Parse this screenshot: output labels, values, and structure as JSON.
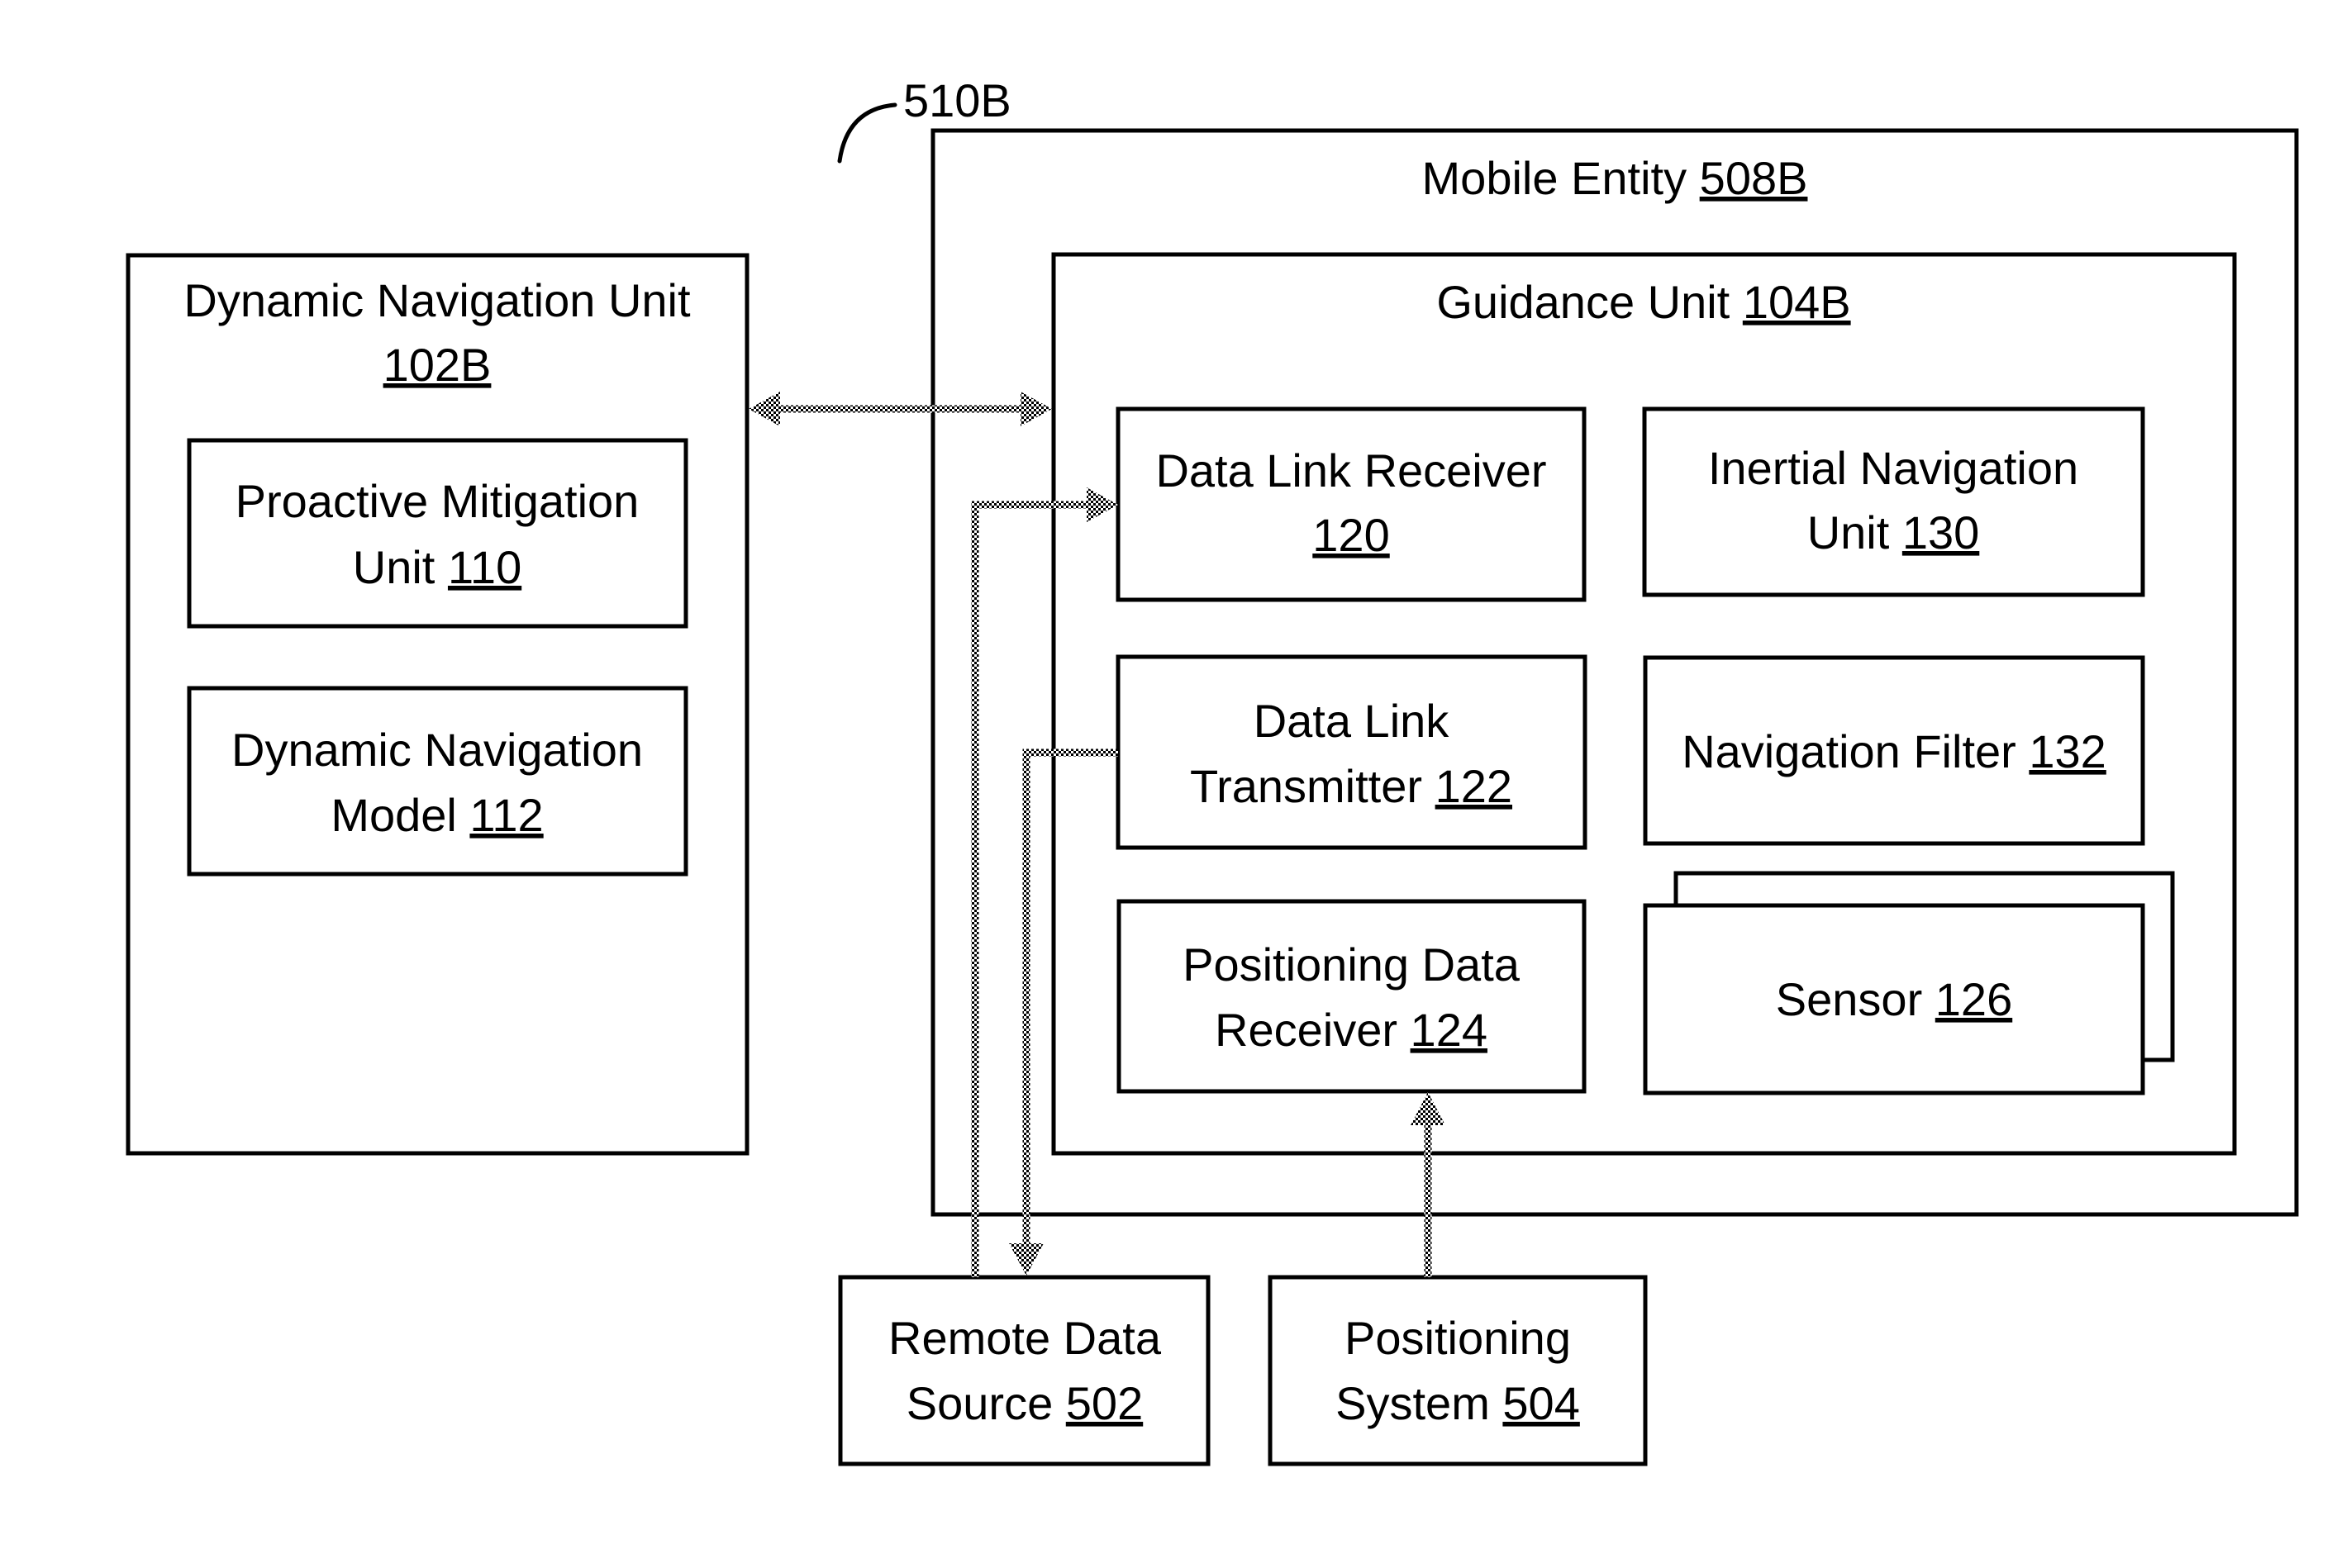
{
  "diagram": {
    "callout": {
      "ref": "510B"
    },
    "dynamic_navigation_unit": {
      "title_line1": "Dynamic Navigation Unit",
      "ref": "102B",
      "children": {
        "proactive_mitigation_unit": {
          "line1": "Proactive Mitigation",
          "line2": "Unit ",
          "ref": "110"
        },
        "dynamic_navigation_model": {
          "line1": "Dynamic Navigation",
          "line2": "Model ",
          "ref": "112"
        }
      }
    },
    "mobile_entity": {
      "title": "Mobile Entity ",
      "ref": "508B"
    },
    "guidance_unit": {
      "title": "Guidance Unit ",
      "ref": "104B",
      "components": {
        "data_link_receiver": {
          "line1": "Data Link Receiver",
          "ref": "120"
        },
        "inertial_navigation_unit": {
          "line1": "Inertial Navigation",
          "line2": "Unit ",
          "ref": "130"
        },
        "data_link_transmitter": {
          "line1": "Data Link",
          "line2": "Transmitter ",
          "ref": "122"
        },
        "navigation_filter": {
          "line1": "Navigation Filter ",
          "ref": "132"
        },
        "positioning_data_receiver": {
          "line1": "Positioning Data",
          "line2": "Receiver ",
          "ref": "124"
        },
        "sensor": {
          "line1": "Sensor ",
          "ref": "126"
        }
      }
    },
    "remote_data_source": {
      "line1": "Remote Data",
      "line2": "Source ",
      "ref": "502"
    },
    "positioning_system": {
      "line1": "Positioning",
      "line2": "System ",
      "ref": "504"
    },
    "connections": [
      {
        "from": "Dynamic Navigation Unit 102B",
        "to": "Guidance Unit 104B",
        "direction": "bidirectional"
      },
      {
        "from": "Remote Data Source 502",
        "to": "Data Link Receiver 120",
        "direction": "forward"
      },
      {
        "from": "Data Link Transmitter 122",
        "to": "Remote Data Source 502",
        "direction": "forward"
      },
      {
        "from": "Positioning System 504",
        "to": "Positioning Data Receiver 124",
        "direction": "forward"
      }
    ]
  }
}
